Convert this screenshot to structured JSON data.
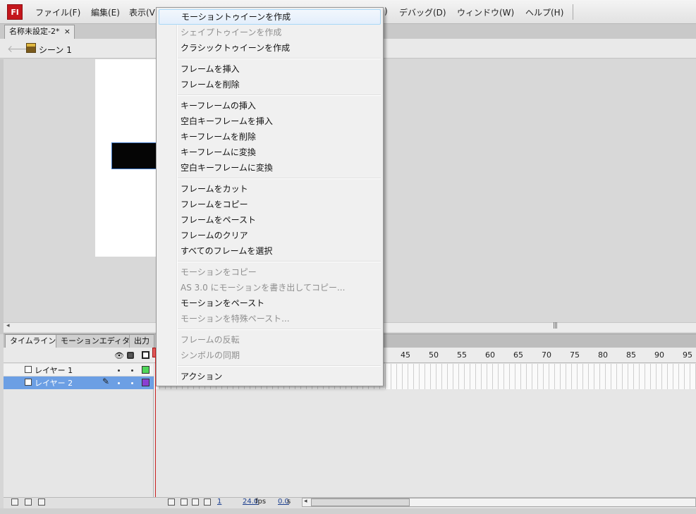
{
  "app": {
    "logo_text": "Fl"
  },
  "menubar": {
    "items": [
      "ファイル(F)",
      "編集(E)",
      "表示(V)",
      ")",
      "デバッグ(D)",
      "ウィンドウ(W)",
      "ヘルプ(H)"
    ]
  },
  "document": {
    "tab_title": "名称未設定-2*",
    "close_glyph": "×"
  },
  "editbar": {
    "scene_label": "シーン 1"
  },
  "panel_tabs": [
    "タイムライン",
    "モーションエディタ",
    "出力"
  ],
  "timeline": {
    "layers": [
      {
        "name": "レイヤー 1",
        "color": "#4fd65a",
        "selected": false
      },
      {
        "name": "レイヤー 2",
        "color": "#8a3fd2",
        "selected": true
      }
    ],
    "ruler_numbers": [
      "45",
      "50",
      "55",
      "60",
      "65",
      "70",
      "75",
      "80",
      "85",
      "90",
      "95"
    ],
    "status": {
      "current_frame": "1",
      "fps_value": "24.0",
      "fps_unit": "fps",
      "time_value": "0.0",
      "time_unit": "s"
    }
  },
  "context_menu": {
    "groups": [
      [
        {
          "label": "モーショントゥイーンを作成",
          "enabled": true,
          "highlighted": true
        },
        {
          "label": "シェイプトゥイーンを作成",
          "enabled": false
        },
        {
          "label": "クラシックトゥイーンを作成",
          "enabled": true
        }
      ],
      [
        {
          "label": "フレームを挿入",
          "enabled": true
        },
        {
          "label": "フレームを削除",
          "enabled": true
        }
      ],
      [
        {
          "label": "キーフレームの挿入",
          "enabled": true
        },
        {
          "label": "空白キーフレームを挿入",
          "enabled": true
        },
        {
          "label": "キーフレームを削除",
          "enabled": true
        },
        {
          "label": "キーフレームに変換",
          "enabled": true
        },
        {
          "label": "空白キーフレームに変換",
          "enabled": true
        }
      ],
      [
        {
          "label": "フレームをカット",
          "enabled": true
        },
        {
          "label": "フレームをコピー",
          "enabled": true
        },
        {
          "label": "フレームをペースト",
          "enabled": true
        },
        {
          "label": "フレームのクリア",
          "enabled": true
        },
        {
          "label": "すべてのフレームを選択",
          "enabled": true
        }
      ],
      [
        {
          "label": "モーションをコピー",
          "enabled": false
        },
        {
          "label": "AS 3.0 にモーションを書き出してコピー...",
          "enabled": false
        },
        {
          "label": "モーションをペースト",
          "enabled": true
        },
        {
          "label": "モーションを特殊ペースト...",
          "enabled": false
        }
      ],
      [
        {
          "label": "フレームの反転",
          "enabled": false
        },
        {
          "label": "シンボルの同期",
          "enabled": false
        }
      ],
      [
        {
          "label": "アクション",
          "enabled": true
        }
      ]
    ]
  }
}
